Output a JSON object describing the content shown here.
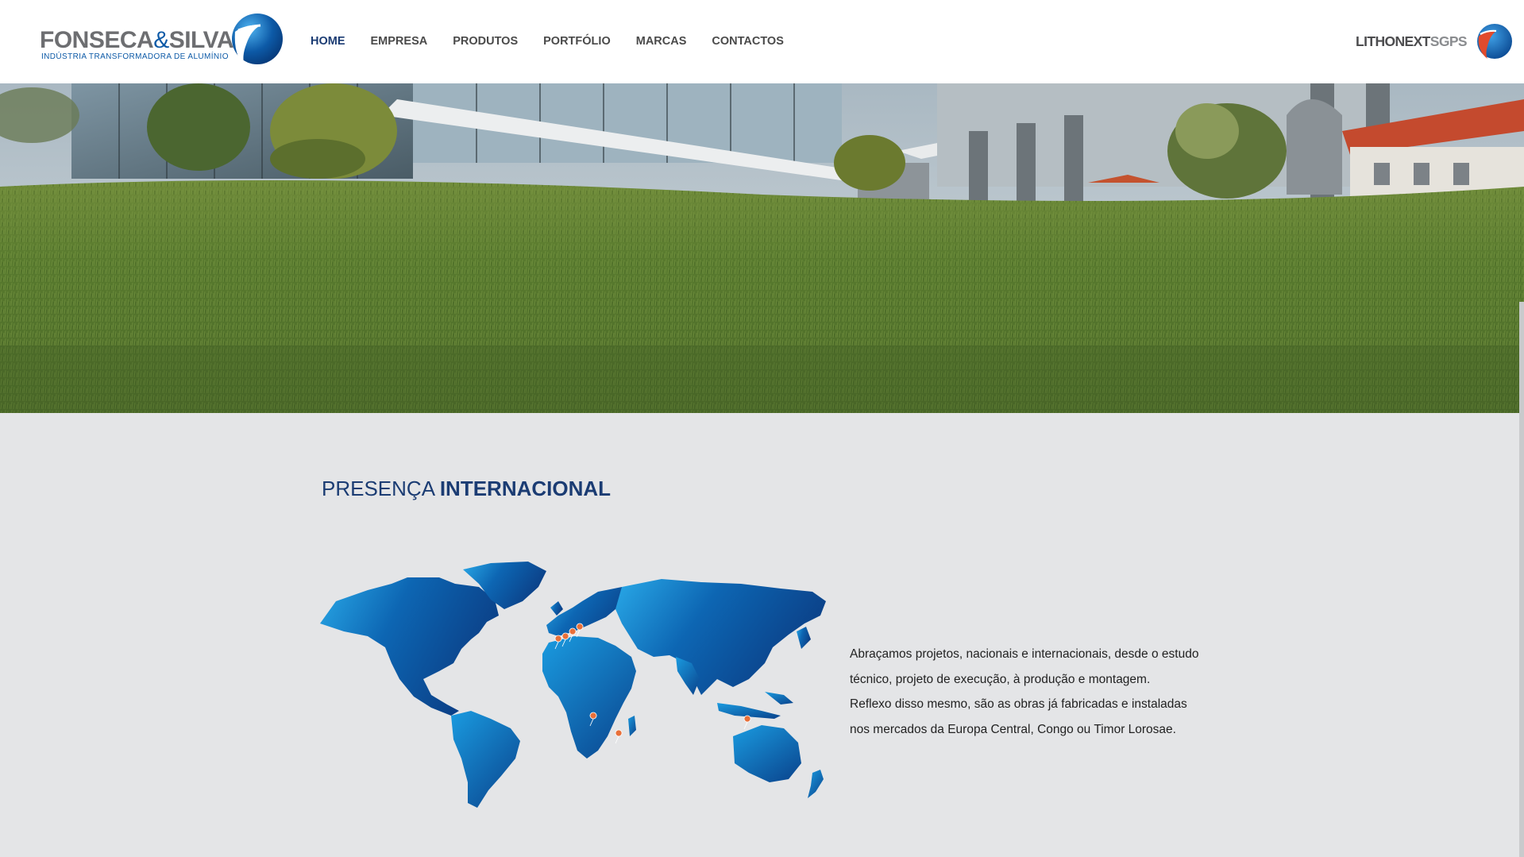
{
  "header": {
    "logo": {
      "name_part1": "FONSECA",
      "name_amp": "&",
      "name_part2": "SILVA",
      "subtitle": "INDÚSTRIA TRANSFORMADORA DE ALUMÍNIO"
    },
    "nav": [
      {
        "label": "HOME",
        "active": true
      },
      {
        "label": "EMPRESA",
        "active": false
      },
      {
        "label": "PRODUTOS",
        "active": false
      },
      {
        "label": "PORTFÓLIO",
        "active": false
      },
      {
        "label": "MARCAS",
        "active": false
      },
      {
        "label": "CONTACTOS",
        "active": false
      }
    ],
    "partner": {
      "name_main": "LITHONEXT",
      "name_suffix": "SGPS"
    }
  },
  "section": {
    "title_light": "PRESENÇA ",
    "title_bold": "INTERNACIONAL",
    "paragraph_lines": [
      "Abraçamos projetos, nacionais e internacionais, desde o estudo",
      "técnico, projeto de execução, à produção e montagem.",
      "Reflexo disso mesmo, são as obras já fabricadas e instaladas",
      "nos mercados da Europa Central, Congo ou Timor Lorosae."
    ]
  },
  "colors": {
    "brand_blue": "#1b3c73",
    "accent_blue": "#0d5aa7",
    "map_gradient_light": "#29a9e8",
    "map_gradient_dark": "#0b3f86",
    "marker_orange": "#e8703a",
    "section_bg": "#e4e5e7"
  },
  "icons": {
    "logo_mark": "blue-sphere-logo-icon",
    "partner_mark": "blue-red-sphere-logo-icon",
    "map_marker": "location-pin-icon"
  }
}
